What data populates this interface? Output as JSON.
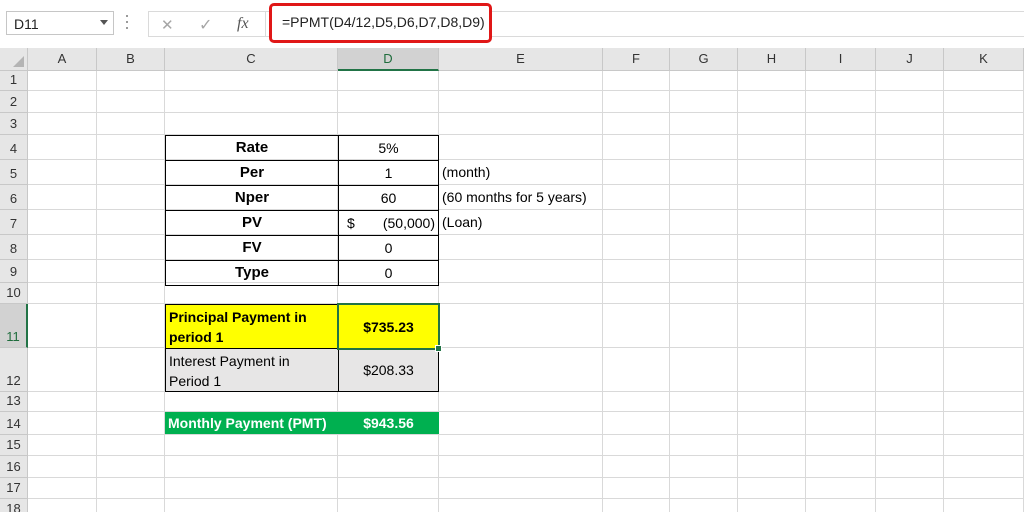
{
  "formula_bar": {
    "name_box": "D11",
    "formula": "=PPMT(D4/12,D5,D6,D7,D8,D9)",
    "cancel_icon": "close-icon",
    "enter_icon": "check-icon",
    "fx_label": "fx"
  },
  "columns": [
    "A",
    "B",
    "C",
    "D",
    "E",
    "F",
    "G",
    "H",
    "I",
    "J",
    "K"
  ],
  "rows": [
    "1",
    "2",
    "3",
    "4",
    "5",
    "6",
    "7",
    "8",
    "9",
    "10",
    "11",
    "12",
    "13",
    "14",
    "15",
    "16",
    "17",
    "18"
  ],
  "selected_cell": {
    "column": "D",
    "row": "11"
  },
  "inputs": [
    {
      "label": "Rate",
      "value": "5%",
      "note": ""
    },
    {
      "label": "Per",
      "value": "1",
      "note": "(month)"
    },
    {
      "label": "Nper",
      "value": "60",
      "note": "(60 months for 5 years)"
    },
    {
      "label": "PV",
      "currency": "$",
      "value": "(50,000)",
      "note": "(Loan)"
    },
    {
      "label": "FV",
      "value": "0",
      "note": ""
    },
    {
      "label": "Type",
      "value": "0",
      "note": ""
    }
  ],
  "results": {
    "principal": {
      "label_line1": "Principal Payment in",
      "label_line2": "period 1",
      "value": "$735.23"
    },
    "interest": {
      "label_line1": "Interest Payment in",
      "label_line2": "Period 1",
      "value": "$208.33"
    },
    "monthly": {
      "label": "Monthly Payment (PMT)",
      "value": "$943.56"
    }
  },
  "colors": {
    "highlight_border": "#e01717",
    "principal_fill": "#ffff00",
    "interest_fill": "#e7e6e6",
    "monthly_fill": "#00b050",
    "selection": "#217346"
  }
}
